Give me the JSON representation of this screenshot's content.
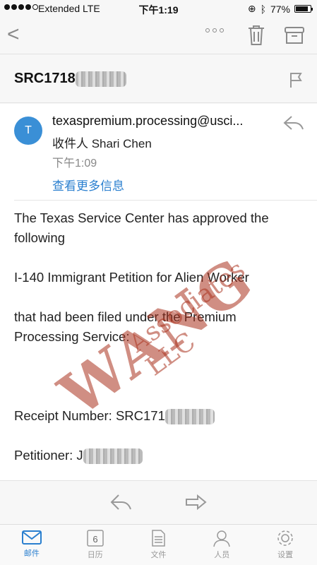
{
  "status": {
    "carrier": "Extended  LTE",
    "time": "下午1:19",
    "battery": "77%"
  },
  "subject": {
    "prefix": "SRC1718"
  },
  "email": {
    "avatar_letter": "T",
    "sender": "texaspremium.processing@usci...",
    "recipient": "收件人 Shari Chen",
    "time": "下午1:09",
    "more_info": "查看更多信息",
    "body": {
      "line1": "The Texas Service Center has approved the following",
      "line2": "I-140 Immigrant Petition for Alien Worker",
      "line3": "that had been filed under the Premium Processing Service:",
      "receipt_label": "Receipt Number: SRC171",
      "petitioner_label": "Petitioner: J"
    }
  },
  "watermark": {
    "main": "WANG",
    "sub": "Associates LLC"
  },
  "tabs": [
    {
      "label": "邮件",
      "icon": "mail-icon",
      "active": true
    },
    {
      "label": "日历",
      "icon": "calendar-icon",
      "day": "6"
    },
    {
      "label": "文件",
      "icon": "file-icon"
    },
    {
      "label": "人员",
      "icon": "people-icon"
    },
    {
      "label": "设置",
      "icon": "settings-icon"
    }
  ],
  "colors": {
    "accent": "#2a7fcf",
    "avatar": "#3a8fd6",
    "watermark": "#aa321e"
  }
}
